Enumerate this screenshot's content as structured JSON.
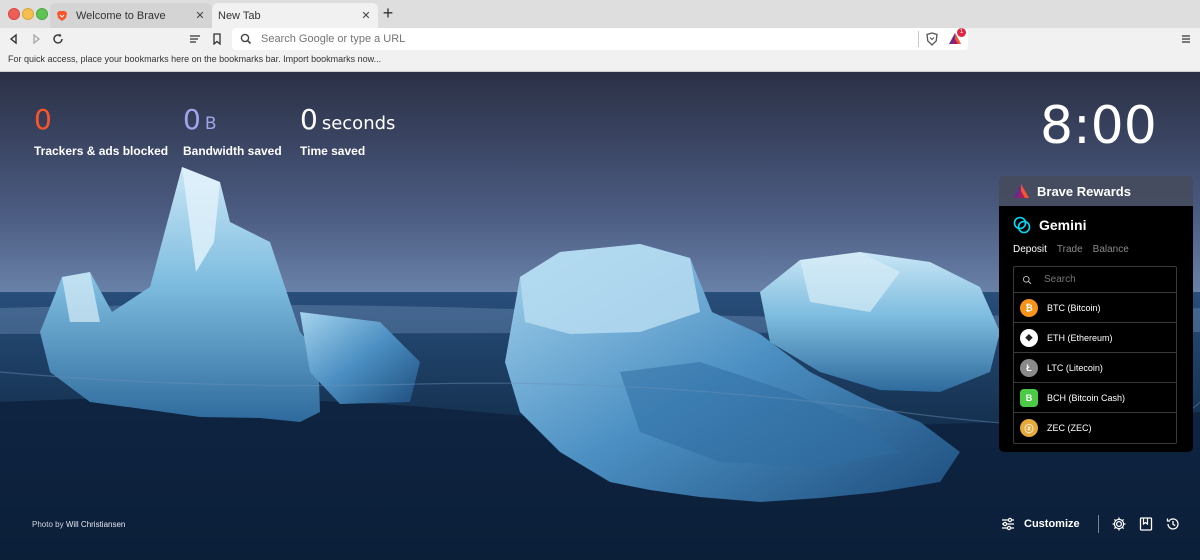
{
  "tabs": [
    {
      "title": "Welcome to Brave",
      "close": "✕"
    },
    {
      "title": "New Tab",
      "close": "✕"
    }
  ],
  "new_tab_label": "+",
  "omnibox": {
    "placeholder": "Search Google or type a URL",
    "value": ""
  },
  "rewards_badge_count": "1",
  "bookmarks_bar": {
    "text": "For quick access, place your bookmarks here on the bookmarks bar. Import bookmarks now..."
  },
  "stats": [
    {
      "value": "0",
      "unit": "",
      "label": "Trackers & ads blocked"
    },
    {
      "value": "0",
      "unit": "B",
      "label": "Bandwidth saved"
    },
    {
      "value": "0",
      "unit": "seconds",
      "label": "Time saved"
    }
  ],
  "clock": "8:00",
  "rewards": {
    "title": "Brave Rewards"
  },
  "gemini": {
    "title": "Gemini",
    "tabs": [
      "Deposit",
      "Trade",
      "Balance"
    ],
    "active_tab": "Deposit",
    "search_placeholder": "Search",
    "coins": [
      {
        "label": "BTC (Bitcoin)",
        "glyph": "₿",
        "color": "#f7931a"
      },
      {
        "label": "ETH (Ethereum)",
        "glyph": "◆",
        "color": "#ffffff"
      },
      {
        "label": "LTC (Litecoin)",
        "glyph": "Ł",
        "color": "#8a8a8a"
      },
      {
        "label": "BCH (Bitcoin Cash)",
        "glyph": "B",
        "color": "#4cc947"
      },
      {
        "label": "ZEC (ZEC)",
        "glyph": "ⓩ",
        "color": "#e5a93d"
      }
    ]
  },
  "photo_credit": {
    "prefix": "Photo by",
    "author": "Will Christiansen"
  },
  "customize_label": "Customize",
  "colors": {
    "brave_orange": "#fb542b",
    "bandwidth_purple": "#a0a5eb"
  }
}
